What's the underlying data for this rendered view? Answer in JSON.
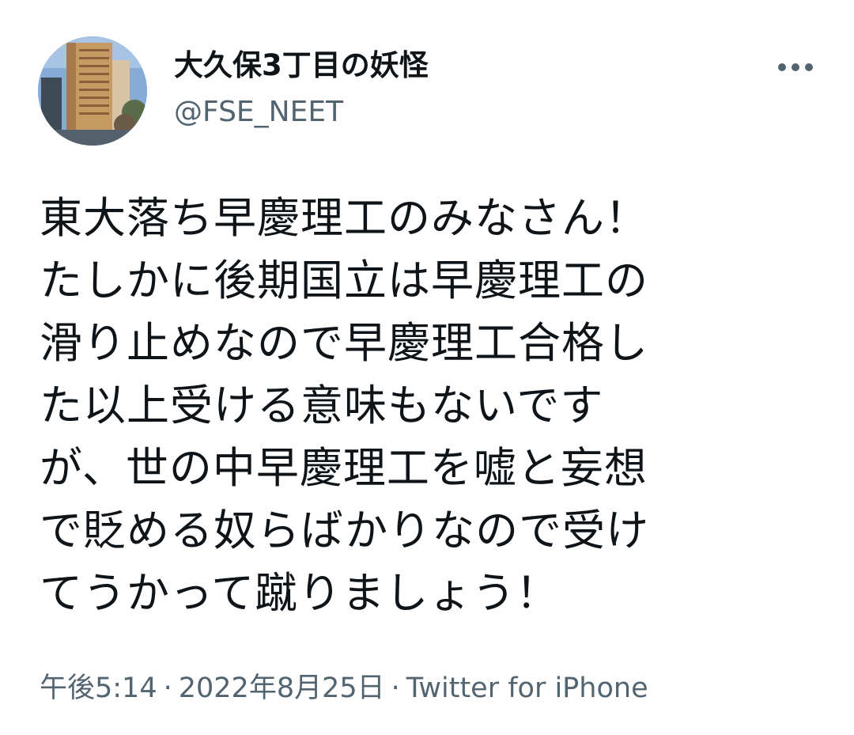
{
  "user": {
    "display_name": "大久保3丁目の妖怪",
    "handle": "@FSE_NEET",
    "avatar_icon": "building-photo-avatar"
  },
  "more_icon": "more-horizontal-icon",
  "tweet": {
    "lines": [
      "東大落ち早慶理工のみなさん！",
      "たしかに後期国立は早慶理工の",
      "滑り止めなので早慶理工合格し",
      "た以上受ける意味もないです",
      "が、世の中早慶理工を嘘と妄想",
      "で貶める奴らばかりなので受け",
      "てうかって蹴りましょう！"
    ]
  },
  "meta": {
    "time": "午後5:14",
    "date": "2022年8月25日",
    "separator": "·",
    "source": "Twitter for iPhone"
  },
  "colors": {
    "text": "#0f1419",
    "secondary": "#536471",
    "background": "#ffffff"
  }
}
